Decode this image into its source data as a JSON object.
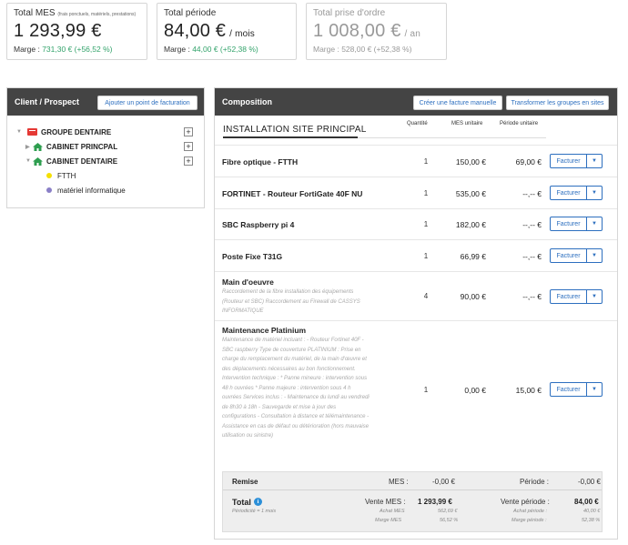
{
  "cards": [
    {
      "title": "Total MES",
      "title_note": "(frais ponctuels, matériels, prestations)",
      "value": "1 293,99 €",
      "suffix": "",
      "margin_label": "Marge :",
      "margin_value": "731,30 € (+56,52 %)"
    },
    {
      "title": "Total période",
      "title_note": "",
      "value": "84,00 €",
      "suffix": "/ mois",
      "margin_label": "Marge :",
      "margin_value": "44,00 € (+52,38 %)"
    },
    {
      "title": "Total prise d'ordre",
      "title_note": "",
      "value": "1 008,00 €",
      "suffix": "/ an",
      "margin_label": "Marge :",
      "margin_value": "528,00 € (+52,38 %)"
    }
  ],
  "client": {
    "title": "Client / Prospect",
    "add_button": "Ajouter un point de facturation",
    "group": "GROUPE DENTAIRE",
    "cabinet1": "CABINET PRINCPAL",
    "cabinet2": "CABINET DENTAIRE",
    "sub1": "FTTH",
    "sub2": "matériel informatique",
    "plus": "+"
  },
  "composition": {
    "title": "Composition",
    "btn_create": "Créer une facture manuelle",
    "btn_transform": "Transformer les groupes en sites",
    "section": "INSTALLATION SITE PRINCIPAL",
    "col_qty": "Quantité",
    "col_mes": "MES unitaire",
    "col_period": "Période unitaire",
    "invoice_label": "Facturer",
    "caret": "▼",
    "lines": [
      {
        "name": "Fibre optique - FTTH",
        "desc": "",
        "qty": "1",
        "mes": "150,00 €",
        "period": "69,00 €"
      },
      {
        "name": "FORTINET - Routeur FortiGate 40F NU",
        "desc": "",
        "qty": "1",
        "mes": "535,00 €",
        "period": "--,-- €"
      },
      {
        "name": "SBC Raspberry pi 4",
        "desc": "",
        "qty": "1",
        "mes": "182,00 €",
        "period": "--,-- €"
      },
      {
        "name": "Poste Fixe T31G",
        "desc": "",
        "qty": "1",
        "mes": "66,99 €",
        "period": "--,-- €"
      },
      {
        "name": "Main d'oeuvre",
        "desc": "Raccordement de la fibre installation des équipements (Routeur et SBC) Raccordement au Firewall de CASSYS INFORMATIQUE",
        "qty": "4",
        "mes": "90,00 €",
        "period": "--,-- €"
      },
      {
        "name": "Maintenance Platinium",
        "desc": "Maintenance de matériel incluant : - Routeur Fortinet 40F - SBC raspberry Type de couverture PLATINIUM : Prise en charge du remplacement du matériel, de la main d'œuvre et des déplacements nécessaires au bon fonctionnement. Intervention technique : * Panne mineure : intervention sous 48 h ouvrées * Panne majeure : intervention sous 4 h ouvrées Services inclus : - Maintenance du lundi au vendredi de 8h30 à 18h - Sauvegarde et mise à jour des configurations - Consultation à distance et télémaintenance - Assistance en cas de défaut ou détérioration (hors mauvaise utilisation ou sinistre)",
        "qty": "1",
        "mes": "0,00 €",
        "period": "15,00 €"
      }
    ],
    "summary": {
      "remise": "Remise",
      "mes_label": "MES :",
      "mes_value": "-0,00 €",
      "period_label": "Période :",
      "period_value": "-0,00 €",
      "total": "Total",
      "periodicity": "Périodicité = 1 mois",
      "vente_mes_label": "Vente MES :",
      "vente_mes_value": "1 293,99 €",
      "achat_mes_label": "Achat MES",
      "achat_mes_value": "562,69 €",
      "marge_mes_label": "Marge MES",
      "marge_mes_value": "56,52 %",
      "vente_period_label": "Vente période :",
      "vente_period_value": "84,00 €",
      "achat_period_label": "Achat période :",
      "achat_period_value": "40,00 €",
      "marge_period_label": "Marge période :",
      "marge_period_value": "52,38 %"
    }
  }
}
